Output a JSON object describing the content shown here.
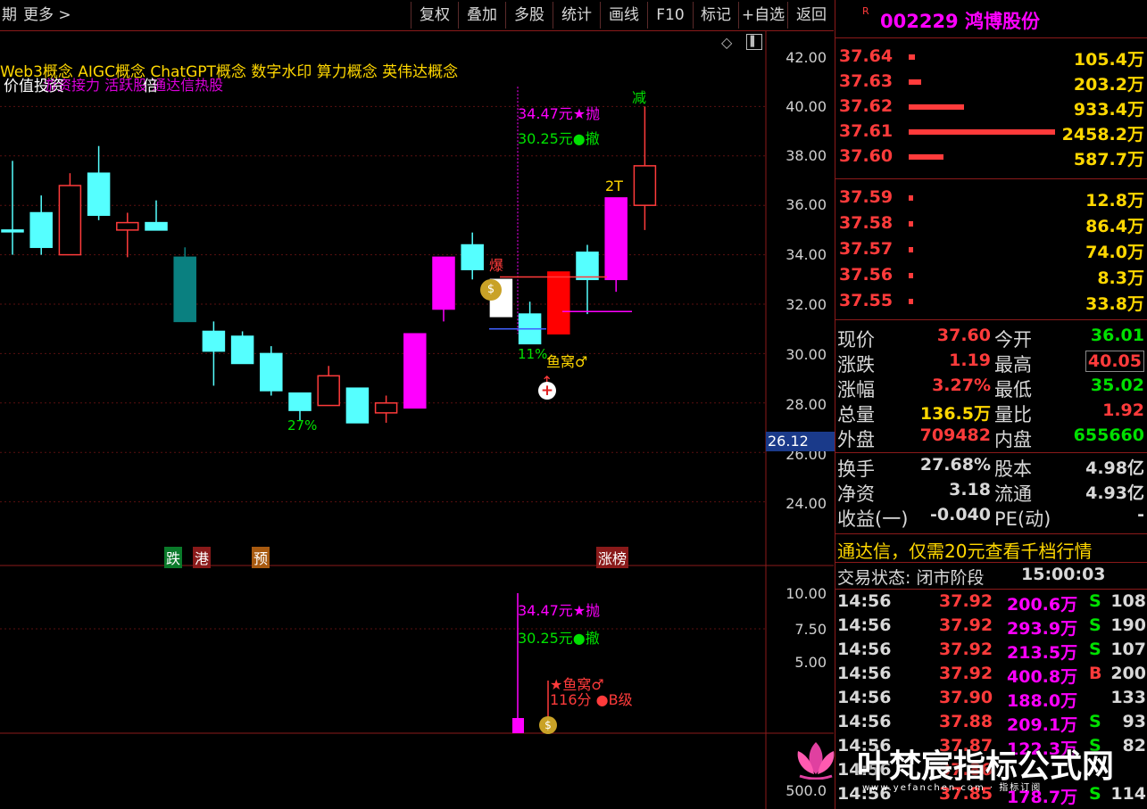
{
  "toolbar": {
    "left_labels": [
      "期",
      "更多 >"
    ],
    "buttons": [
      "复权",
      "叠加",
      "多股",
      "统计",
      "画线",
      "F10",
      "标记",
      "+自选",
      "返回"
    ]
  },
  "main_chart": {
    "concepts_line": "Web3概念 AIGC概念 ChatGPT概念 数字水印 算力概念 英伟达概念",
    "overlap_line_1": "价值投资",
    "overlap_line_2": "倍",
    "overlap_line_3": "游资接力 活跃股 通达信热股",
    "y_ticks": [
      "42.00",
      "40.00",
      "38.00",
      "36.00",
      "34.00",
      "32.00",
      "30.00",
      "28.00",
      "26.00",
      "24.00"
    ],
    "current_price_tag": "26.12",
    "annotations": {
      "sell_label": "34.47元★抛",
      "cancel_label": "30.25元●撤",
      "reduce_label": "减",
      "twoT_label": "2T",
      "burst_label": "爆",
      "pct11": "11%",
      "nest_label": "鱼窝♂",
      "pct27": "27%"
    },
    "bottom_tags": [
      "跌",
      "港",
      "预",
      "涨榜"
    ]
  },
  "sub_chart": {
    "y_ticks": [
      "10.00",
      "7.50",
      "5.00"
    ],
    "bottom_tick": "500.0",
    "sell_label": "34.47元★抛",
    "cancel_label": "30.25元●撤",
    "nest_label": "★鱼窝♂",
    "grade_label": "116分 ●B级"
  },
  "chart_data": {
    "type": "candlestick",
    "candles": [
      {
        "o": 35.0,
        "c": 35.0,
        "h": 37.8,
        "l": 34.0,
        "dir": "down"
      },
      {
        "o": 35.7,
        "c": 34.3,
        "h": 36.4,
        "l": 34.0,
        "dir": "down"
      },
      {
        "o": 34.0,
        "c": 36.8,
        "h": 37.3,
        "l": 34.0,
        "dir": "up"
      },
      {
        "o": 37.3,
        "c": 35.6,
        "h": 38.4,
        "l": 35.4,
        "dir": "down"
      },
      {
        "o": 35.0,
        "c": 35.3,
        "h": 35.7,
        "l": 33.9,
        "dir": "up"
      },
      {
        "o": 35.3,
        "c": 35.0,
        "h": 36.2,
        "l": 35.0,
        "dir": "down"
      },
      {
        "o": 33.9,
        "c": 31.3,
        "h": 34.3,
        "l": 31.3,
        "dir": "down-teal"
      },
      {
        "o": 30.9,
        "c": 30.1,
        "h": 31.3,
        "l": 28.7,
        "dir": "down"
      },
      {
        "o": 30.7,
        "c": 29.6,
        "h": 30.9,
        "l": 29.6,
        "dir": "down"
      },
      {
        "o": 30.0,
        "c": 28.5,
        "h": 30.3,
        "l": 28.3,
        "dir": "down"
      },
      {
        "o": 28.4,
        "c": 27.7,
        "h": 28.4,
        "l": 27.3,
        "dir": "down"
      },
      {
        "o": 27.9,
        "c": 29.1,
        "h": 29.5,
        "l": 27.9,
        "dir": "up"
      },
      {
        "o": 28.6,
        "c": 27.2,
        "h": 28.6,
        "l": 27.2,
        "dir": "down"
      },
      {
        "o": 27.6,
        "c": 28.0,
        "h": 28.3,
        "l": 27.2,
        "dir": "up"
      },
      {
        "o": 27.8,
        "c": 30.8,
        "h": 30.8,
        "l": 27.8,
        "dir": "up-magenta"
      },
      {
        "o": 31.8,
        "c": 33.9,
        "h": 33.9,
        "l": 31.3,
        "dir": "up-magenta"
      },
      {
        "o": 34.4,
        "c": 33.4,
        "h": 34.9,
        "l": 33.0,
        "dir": "down"
      },
      {
        "o": 31.5,
        "c": 33.0,
        "h": 33.0,
        "l": 31.5,
        "dir": "white"
      },
      {
        "o": 31.6,
        "c": 30.4,
        "h": 32.1,
        "l": 30.4,
        "dir": "down"
      },
      {
        "o": 30.8,
        "c": 33.3,
        "h": 33.3,
        "l": 30.8,
        "dir": "up-red"
      },
      {
        "o": 33.0,
        "c": 34.1,
        "h": 34.4,
        "l": 31.6,
        "dir": "down"
      },
      {
        "o": 33.0,
        "c": 36.3,
        "h": 36.3,
        "l": 32.5,
        "dir": "up-magenta"
      },
      {
        "o": 36.0,
        "c": 37.6,
        "h": 40.0,
        "l": 35.0,
        "dir": "up"
      }
    ],
    "ylim": [
      23.0,
      43.0
    ]
  },
  "quote": {
    "r_mark": "R",
    "code_name": "002229 鸿博股份",
    "asks": [
      {
        "price": "37.64",
        "vol": "105.4万"
      },
      {
        "price": "37.63",
        "vol": "203.2万"
      },
      {
        "price": "37.62",
        "vol": "933.4万"
      },
      {
        "price": "37.61",
        "vol": "2458.2万"
      },
      {
        "price": "37.60",
        "vol": "587.7万"
      }
    ],
    "bids": [
      {
        "price": "37.59",
        "vol": "12.8万"
      },
      {
        "price": "37.58",
        "vol": "86.4万"
      },
      {
        "price": "37.57",
        "vol": "74.0万"
      },
      {
        "price": "37.56",
        "vol": "8.3万"
      },
      {
        "price": "37.55",
        "vol": "33.8万"
      }
    ],
    "stats": [
      {
        "l1": "现价",
        "v1": "37.60",
        "l2": "今开",
        "v2": "36.01"
      },
      {
        "l1": "涨跌",
        "v1": "1.19",
        "l2": "最高",
        "v2": "40.05"
      },
      {
        "l1": "涨幅",
        "v1": "3.27%",
        "l2": "最低",
        "v2": "35.02"
      },
      {
        "l1": "总量",
        "v1": "136.5万",
        "l2": "量比",
        "v2": "1.92"
      },
      {
        "l1": "外盘",
        "v1": "709482",
        "l2": "内盘",
        "v2": "655660"
      }
    ],
    "stats2": [
      {
        "l1": "换手",
        "v1": "27.68%",
        "l2": "股本",
        "v2": "4.98亿"
      },
      {
        "l1": "净资",
        "v1": "3.18",
        "l2": "流通",
        "v2": "4.93亿"
      },
      {
        "l1": "收益(一)",
        "v1": "-0.040",
        "l2": "PE(动)",
        "v2": "-"
      }
    ],
    "promo": "通达信，仅需20元查看千档行情",
    "trade_status_label": "交易状态: 闭市阶段",
    "trade_status_time": "15:00:03",
    "ticks": [
      {
        "t": "14:56",
        "p": "37.92",
        "v": "200.6万",
        "s": "S",
        "n": "108"
      },
      {
        "t": "14:56",
        "p": "37.92",
        "v": "293.9万",
        "s": "S",
        "n": "190"
      },
      {
        "t": "14:56",
        "p": "37.92",
        "v": "213.5万",
        "s": "S",
        "n": "107"
      },
      {
        "t": "14:56",
        "p": "37.92",
        "v": "400.8万",
        "s": "B",
        "n": "200"
      },
      {
        "t": "14:56",
        "p": "37.90",
        "v": "188.0万",
        "s": "",
        "n": "133"
      },
      {
        "t": "14:56",
        "p": "37.88",
        "v": "209.1万",
        "s": "S",
        "n": "93"
      },
      {
        "t": "14:56",
        "p": "37.87",
        "v": "122.3万",
        "s": "S",
        "n": "82"
      },
      {
        "t": "14:56",
        "p": "37.86",
        "v": "",
        "s": "",
        "n": ""
      },
      {
        "t": "14:56",
        "p": "37.85",
        "v": "178.7万",
        "s": "S",
        "n": "114"
      }
    ]
  },
  "watermark": {
    "title": "叶梵宸指标公式网",
    "subtitle": "www.yefanchen.com · 指标订阅"
  }
}
